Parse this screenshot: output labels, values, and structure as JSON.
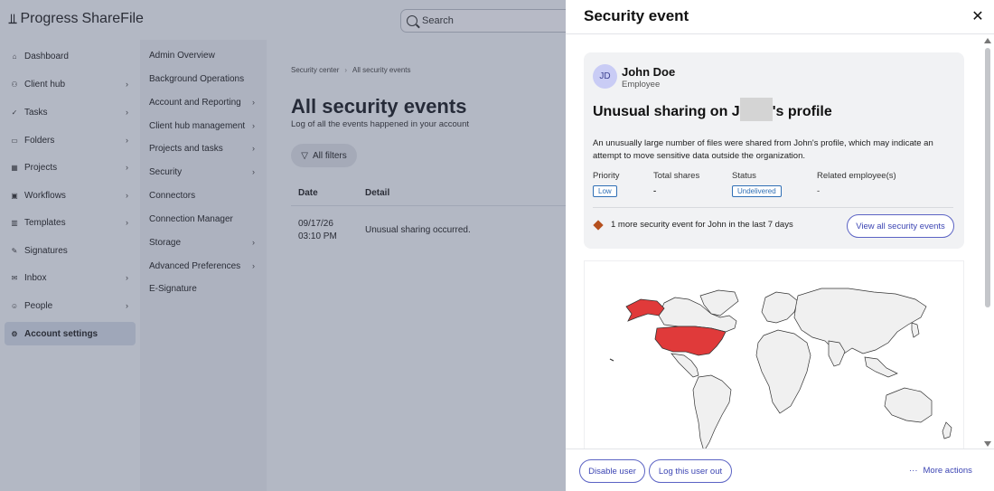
{
  "app": {
    "logo_brand": "Progress",
    "logo_product": "ShareFile",
    "search_placeholder": "Search"
  },
  "sidebar": {
    "items": [
      {
        "label": "Dashboard",
        "icon": "home-icon",
        "chevron": false
      },
      {
        "label": "Client hub",
        "icon": "people-icon",
        "chevron": true
      },
      {
        "label": "Tasks",
        "icon": "check-icon",
        "chevron": true
      },
      {
        "label": "Folders",
        "icon": "folder-icon",
        "chevron": true
      },
      {
        "label": "Projects",
        "icon": "grid-icon",
        "chevron": true
      },
      {
        "label": "Workflows",
        "icon": "workflow-icon",
        "chevron": true
      },
      {
        "label": "Templates",
        "icon": "template-icon",
        "chevron": true
      },
      {
        "label": "Signatures",
        "icon": "pen-icon",
        "chevron": false
      },
      {
        "label": "Inbox",
        "icon": "mail-icon",
        "chevron": true
      },
      {
        "label": "People",
        "icon": "person-icon",
        "chevron": true
      },
      {
        "label": "Account settings",
        "icon": "gear-icon",
        "chevron": false,
        "active": true
      }
    ]
  },
  "submenu": {
    "items": [
      {
        "label": "Admin Overview",
        "chevron": false
      },
      {
        "label": "Background Operations",
        "chevron": false
      },
      {
        "label": "Account and Reporting",
        "chevron": true
      },
      {
        "label": "Client hub management",
        "chevron": true
      },
      {
        "label": "Projects and tasks",
        "chevron": true
      },
      {
        "label": "Security",
        "chevron": true
      },
      {
        "label": "Connectors",
        "chevron": false
      },
      {
        "label": "Connection Manager",
        "chevron": false
      },
      {
        "label": "Storage",
        "chevron": true
      },
      {
        "label": "Advanced Preferences",
        "chevron": true
      },
      {
        "label": "E-Signature",
        "chevron": false
      }
    ]
  },
  "main": {
    "breadcrumb": [
      "Security center",
      "All security events"
    ],
    "title": "All security events",
    "subtitle": "Log of all the events happened in your account",
    "filters_label": "All filters",
    "table": {
      "headers": [
        "Date",
        "Detail"
      ],
      "rows": [
        {
          "date": "09/17/26",
          "time": "03:10 PM",
          "detail": "Unusual sharing occurred."
        }
      ]
    }
  },
  "panel": {
    "title": "Security event",
    "user": {
      "initials": "JD",
      "name": "John Doe",
      "role": "Employee"
    },
    "event_title_prefix": "Unusual sharing on J",
    "event_title_suffix": "'s profile",
    "description": "An unusually large number of files were shared from John's profile, which may indicate an attempt to move sensitive data outside the organization.",
    "meta": {
      "priority_label": "Priority",
      "priority_value": "Low",
      "shares_label": "Total shares",
      "shares_value": "-",
      "status_label": "Status",
      "status_value": "Undelivered",
      "related_label": "Related employee(s)",
      "related_value": "-"
    },
    "related_notice": "1 more security event for John in the last 7 days",
    "view_all_label": "View all security events",
    "map_highlight_color": "#e03a3a",
    "footer": {
      "disable_label": "Disable user",
      "logout_label": "Log this user out",
      "more_label": "More actions"
    }
  }
}
